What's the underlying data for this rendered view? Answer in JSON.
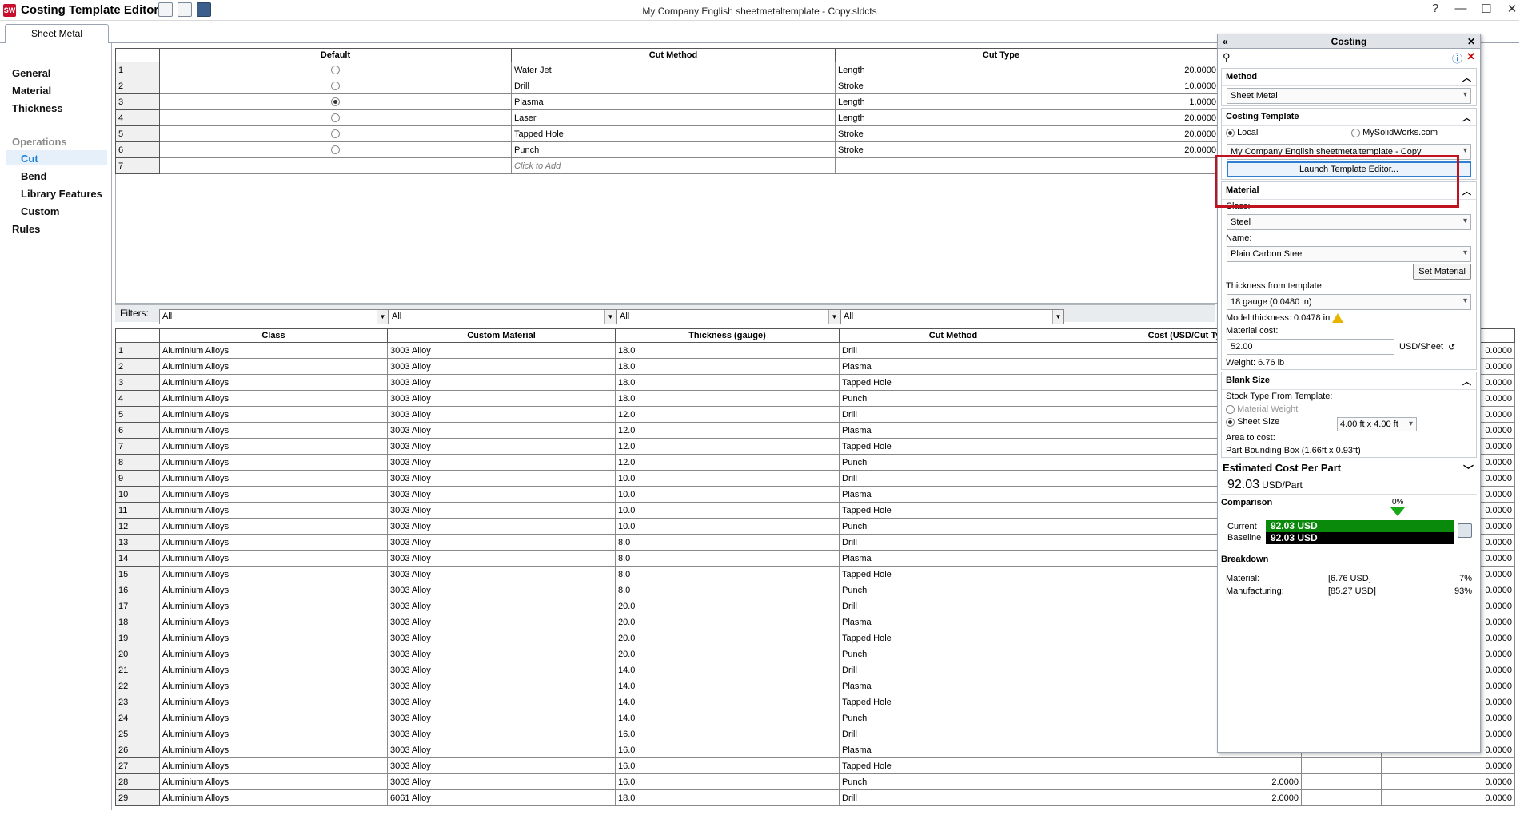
{
  "app": {
    "title": "Costing Template Editor",
    "document_title": "My Company English sheetmetaltemplate - Copy.sldcts",
    "icon_label": "SW",
    "window_buttons": [
      "?",
      "—",
      "☐",
      "✕"
    ]
  },
  "tabs": [
    {
      "label": "Sheet Metal"
    }
  ],
  "leftnav": {
    "general": "General",
    "material": "Material",
    "thickness": "Thickness",
    "operations": "Operations",
    "cut": "Cut",
    "bend": "Bend",
    "library_features": "Library Features",
    "custom": "Custom",
    "rules": "Rules"
  },
  "cut_methods_table": {
    "headers": [
      "Default",
      "Cut Method",
      "Cut Type"
    ],
    "rows": [
      {
        "n": "1",
        "default": false,
        "method": "Water Jet",
        "type": "Length",
        "right": "20.0000"
      },
      {
        "n": "2",
        "default": false,
        "method": "Drill",
        "type": "Stroke",
        "right": "10.0000"
      },
      {
        "n": "3",
        "default": true,
        "method": "Plasma",
        "type": "Length",
        "right": "1.0000"
      },
      {
        "n": "4",
        "default": false,
        "method": "Laser",
        "type": "Length",
        "right": "20.0000"
      },
      {
        "n": "5",
        "default": false,
        "method": "Tapped Hole",
        "type": "Stroke",
        "right": "20.0000"
      },
      {
        "n": "6",
        "default": false,
        "method": "Punch",
        "type": "Stroke",
        "right": "20.0000"
      }
    ],
    "add_row_n": "7",
    "add_placeholder": "Click to Add"
  },
  "filters": {
    "label": "Filters:",
    "values": [
      "All",
      "All",
      "All",
      "All"
    ]
  },
  "materials_table": {
    "headers": [
      "Class",
      "Custom Material",
      "Thickness (gauge)",
      "Cut Method",
      "Cost (USD/Cut Ty"
    ],
    "rows": [
      {
        "n": "1",
        "cls": "Aluminium Alloys",
        "mat": "3003 Alloy",
        "th": "18.0",
        "cut": "Drill",
        "r": "0.0000"
      },
      {
        "n": "2",
        "cls": "Aluminium Alloys",
        "mat": "3003 Alloy",
        "th": "18.0",
        "cut": "Plasma",
        "r": "0.0000"
      },
      {
        "n": "3",
        "cls": "Aluminium Alloys",
        "mat": "3003 Alloy",
        "th": "18.0",
        "cut": "Tapped Hole",
        "r": "0.0000"
      },
      {
        "n": "4",
        "cls": "Aluminium Alloys",
        "mat": "3003 Alloy",
        "th": "18.0",
        "cut": "Punch",
        "r": "0.0000"
      },
      {
        "n": "5",
        "cls": "Aluminium Alloys",
        "mat": "3003 Alloy",
        "th": "12.0",
        "cut": "Drill",
        "r": "0.0000"
      },
      {
        "n": "6",
        "cls": "Aluminium Alloys",
        "mat": "3003 Alloy",
        "th": "12.0",
        "cut": "Plasma",
        "r": "0.0000"
      },
      {
        "n": "7",
        "cls": "Aluminium Alloys",
        "mat": "3003 Alloy",
        "th": "12.0",
        "cut": "Tapped Hole",
        "r": "0.0000"
      },
      {
        "n": "8",
        "cls": "Aluminium Alloys",
        "mat": "3003 Alloy",
        "th": "12.0",
        "cut": "Punch",
        "r": "0.0000"
      },
      {
        "n": "9",
        "cls": "Aluminium Alloys",
        "mat": "3003 Alloy",
        "th": "10.0",
        "cut": "Drill",
        "r": "0.0000"
      },
      {
        "n": "10",
        "cls": "Aluminium Alloys",
        "mat": "3003 Alloy",
        "th": "10.0",
        "cut": "Plasma",
        "r": "0.0000"
      },
      {
        "n": "11",
        "cls": "Aluminium Alloys",
        "mat": "3003 Alloy",
        "th": "10.0",
        "cut": "Tapped Hole",
        "r": "0.0000"
      },
      {
        "n": "12",
        "cls": "Aluminium Alloys",
        "mat": "3003 Alloy",
        "th": "10.0",
        "cut": "Punch",
        "r": "0.0000"
      },
      {
        "n": "13",
        "cls": "Aluminium Alloys",
        "mat": "3003 Alloy",
        "th": "8.0",
        "cut": "Drill",
        "r": "0.0000"
      },
      {
        "n": "14",
        "cls": "Aluminium Alloys",
        "mat": "3003 Alloy",
        "th": "8.0",
        "cut": "Plasma",
        "r": "0.0000"
      },
      {
        "n": "15",
        "cls": "Aluminium Alloys",
        "mat": "3003 Alloy",
        "th": "8.0",
        "cut": "Tapped Hole",
        "r": "0.0000"
      },
      {
        "n": "16",
        "cls": "Aluminium Alloys",
        "mat": "3003 Alloy",
        "th": "8.0",
        "cut": "Punch",
        "r": "0.0000"
      },
      {
        "n": "17",
        "cls": "Aluminium Alloys",
        "mat": "3003 Alloy",
        "th": "20.0",
        "cut": "Drill",
        "r": "0.0000"
      },
      {
        "n": "18",
        "cls": "Aluminium Alloys",
        "mat": "3003 Alloy",
        "th": "20.0",
        "cut": "Plasma",
        "r": "0.0000"
      },
      {
        "n": "19",
        "cls": "Aluminium Alloys",
        "mat": "3003 Alloy",
        "th": "20.0",
        "cut": "Tapped Hole",
        "r": "0.0000"
      },
      {
        "n": "20",
        "cls": "Aluminium Alloys",
        "mat": "3003 Alloy",
        "th": "20.0",
        "cut": "Punch",
        "r": "0.0000"
      },
      {
        "n": "21",
        "cls": "Aluminium Alloys",
        "mat": "3003 Alloy",
        "th": "14.0",
        "cut": "Drill",
        "r": "0.0000"
      },
      {
        "n": "22",
        "cls": "Aluminium Alloys",
        "mat": "3003 Alloy",
        "th": "14.0",
        "cut": "Plasma",
        "r": "0.0000"
      },
      {
        "n": "23",
        "cls": "Aluminium Alloys",
        "mat": "3003 Alloy",
        "th": "14.0",
        "cut": "Tapped Hole",
        "r": "0.0000"
      },
      {
        "n": "24",
        "cls": "Aluminium Alloys",
        "mat": "3003 Alloy",
        "th": "14.0",
        "cut": "Punch",
        "r": "0.0000"
      },
      {
        "n": "25",
        "cls": "Aluminium Alloys",
        "mat": "3003 Alloy",
        "th": "16.0",
        "cut": "Drill",
        "r": "0.0000"
      },
      {
        "n": "26",
        "cls": "Aluminium Alloys",
        "mat": "3003 Alloy",
        "th": "16.0",
        "cut": "Plasma",
        "r": "0.0000"
      },
      {
        "n": "27",
        "cls": "Aluminium Alloys",
        "mat": "3003 Alloy",
        "th": "16.0",
        "cut": "Tapped Hole",
        "r": "0.0000"
      },
      {
        "n": "28",
        "cls": "Aluminium Alloys",
        "mat": "3003 Alloy",
        "th": "16.0",
        "cut": "Punch",
        "r": "0.0000",
        "c2": "2.0000"
      },
      {
        "n": "29",
        "cls": "Aluminium Alloys",
        "mat": "6061 Alloy",
        "th": "18.0",
        "cut": "Drill",
        "r": "0.0000",
        "c2": "2.0000"
      }
    ]
  },
  "costing_panel": {
    "title": "Costing",
    "method": {
      "title": "Method",
      "value": "Sheet Metal"
    },
    "template": {
      "title": "Costing Template",
      "local": "Local",
      "online": "MySolidWorks.com",
      "selected": "My Company English sheetmetaltemplate - Copy",
      "launch": "Launch Template Editor..."
    },
    "material": {
      "title": "Material",
      "class_label": "Class:",
      "class_value": "Steel",
      "name_label": "Name:",
      "name_value": "Plain Carbon Steel",
      "set_material": "Set Material",
      "thickness_label": "Thickness from template:",
      "thickness_value": "18 gauge (0.0480 in)",
      "model_thickness": "Model thickness: 0.0478 in",
      "cost_label": "Material cost:",
      "cost_value": "52.00",
      "cost_unit": "USD/Sheet",
      "weight": "Weight: 6.76 lb"
    },
    "blank": {
      "title": "Blank Size",
      "stock_label": "Stock Type From Template:",
      "material_weight": "Material Weight",
      "sheet_size": "Sheet Size",
      "sheet_size_value": "4.00 ft x 4.00 ft",
      "area_label": "Area to cost:",
      "bounding": "Part Bounding Box (1.66ft x 0.93ft)"
    },
    "estimate": {
      "title": "Estimated Cost Per Part",
      "value": "92.03",
      "unit": "USD/Part",
      "comparison": "Comparison",
      "percent": "0%",
      "current_label": "Current",
      "current_value": "92.03 USD",
      "current_fraction": 1.0,
      "baseline_label": "Baseline",
      "baseline_value": "92.03 USD",
      "baseline_fraction": 1.0,
      "breakdown": "Breakdown",
      "material_label": "Material:",
      "material_value": "[6.76 USD]",
      "material_pct": "7%",
      "manufacturing_label": "Manufacturing:",
      "manufacturing_value": "[85.27 USD]",
      "manufacturing_pct": "93%"
    }
  }
}
